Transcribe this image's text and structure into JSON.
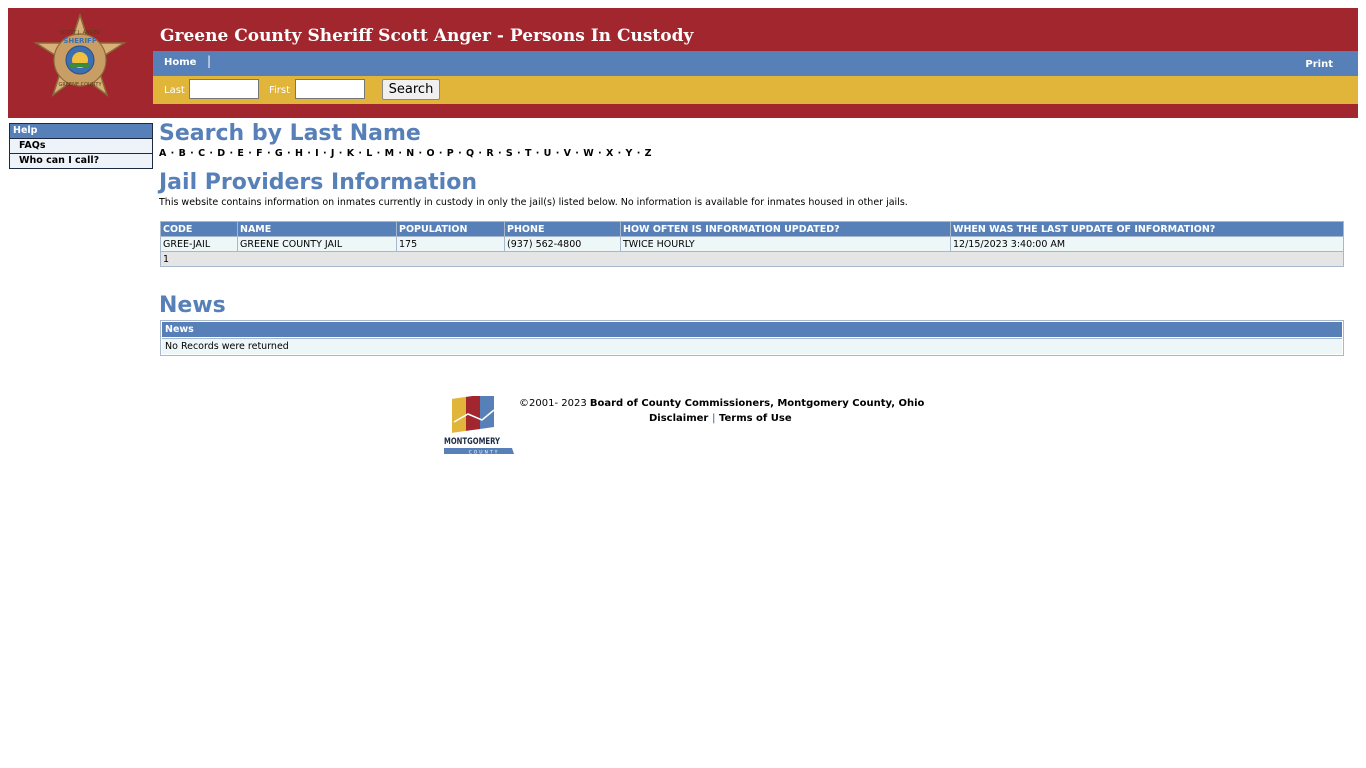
{
  "header": {
    "title": "Greene County Sheriff Scott Anger - Persons In Custody",
    "badge_text_top": "SCOTT J. ANGER",
    "badge_text_mid": "SHERIFF",
    "badge_text_bottom": "GREENE COUNTY",
    "colors": {
      "banner": "#a2262d",
      "nav": "#5780b8",
      "search": "#e1b43a"
    }
  },
  "nav": {
    "home": "Home",
    "separator": "|",
    "print": "Print"
  },
  "search": {
    "last_label": "Last",
    "last_value": "",
    "first_label": "First",
    "first_value": "",
    "button": "Search"
  },
  "sidebar": {
    "header": "Help",
    "items": [
      {
        "label": "FAQs"
      },
      {
        "label": "Who can I call?"
      }
    ]
  },
  "search_by_last_name": {
    "heading": "Search by Last Name",
    "letters": [
      "A",
      "B",
      "C",
      "D",
      "E",
      "F",
      "G",
      "H",
      "I",
      "J",
      "K",
      "L",
      "M",
      "N",
      "O",
      "P",
      "Q",
      "R",
      "S",
      "T",
      "U",
      "V",
      "W",
      "X",
      "Y",
      "Z"
    ]
  },
  "providers": {
    "heading": "Jail Providers Information",
    "description": "This website contains information on inmates currently in custody in only the jail(s) listed below. No information is available for inmates housed in other jails.",
    "columns": [
      "CODE",
      "NAME",
      "POPULATION",
      "PHONE",
      "HOW OFTEN IS INFORMATION UPDATED?",
      "WHEN WAS THE LAST UPDATE OF INFORMATION?"
    ],
    "rows": [
      [
        "GREE-JAIL",
        "GREENE COUNTY JAIL",
        "175",
        "(937) 562-4800",
        "TWICE HOURLY",
        "12/15/2023 3:40:00 AM"
      ]
    ],
    "pager": "1"
  },
  "news": {
    "heading": "News",
    "table_header": "News",
    "empty_text": "No Records were returned"
  },
  "footer": {
    "copyright_prefix": "©2001- 2023",
    "copyright_org": "Board of County Commissioners, Montgomery County, Ohio",
    "disclaimer": "Disclaimer",
    "separator": "|",
    "terms": "Terms of Use",
    "logo_text": "MONTGOMERY",
    "logo_sub": "COUNTY"
  }
}
